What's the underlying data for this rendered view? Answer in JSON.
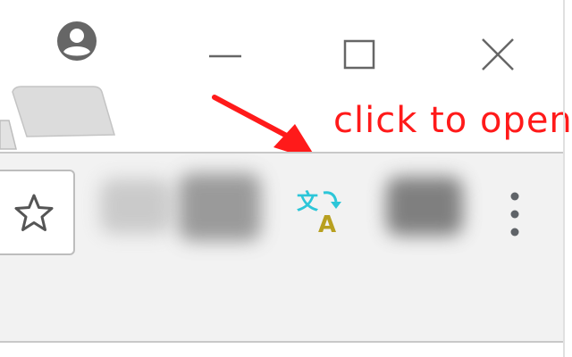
{
  "annotation": {
    "text": "click to open",
    "color": "#ff1a1a"
  },
  "titlebar": {
    "profile_icon": "account-circle-icon",
    "minimize_icon": "minimize-icon",
    "maximize_icon": "maximize-icon",
    "close_icon": "close-icon"
  },
  "toolbar": {
    "bookmark_icon": "star-icon",
    "translate_extension_icon": "translate-icon",
    "translate_glyph_top": "文",
    "translate_glyph_bottom": "A",
    "menu_icon": "more-vert-icon"
  },
  "colors": {
    "toolbar_bg": "#f2f2f2",
    "translate_cyan": "#2cc6d8",
    "translate_gold": "#b8a020",
    "arrow_red": "#ff1a1a",
    "icon_gray": "#5f6368"
  }
}
